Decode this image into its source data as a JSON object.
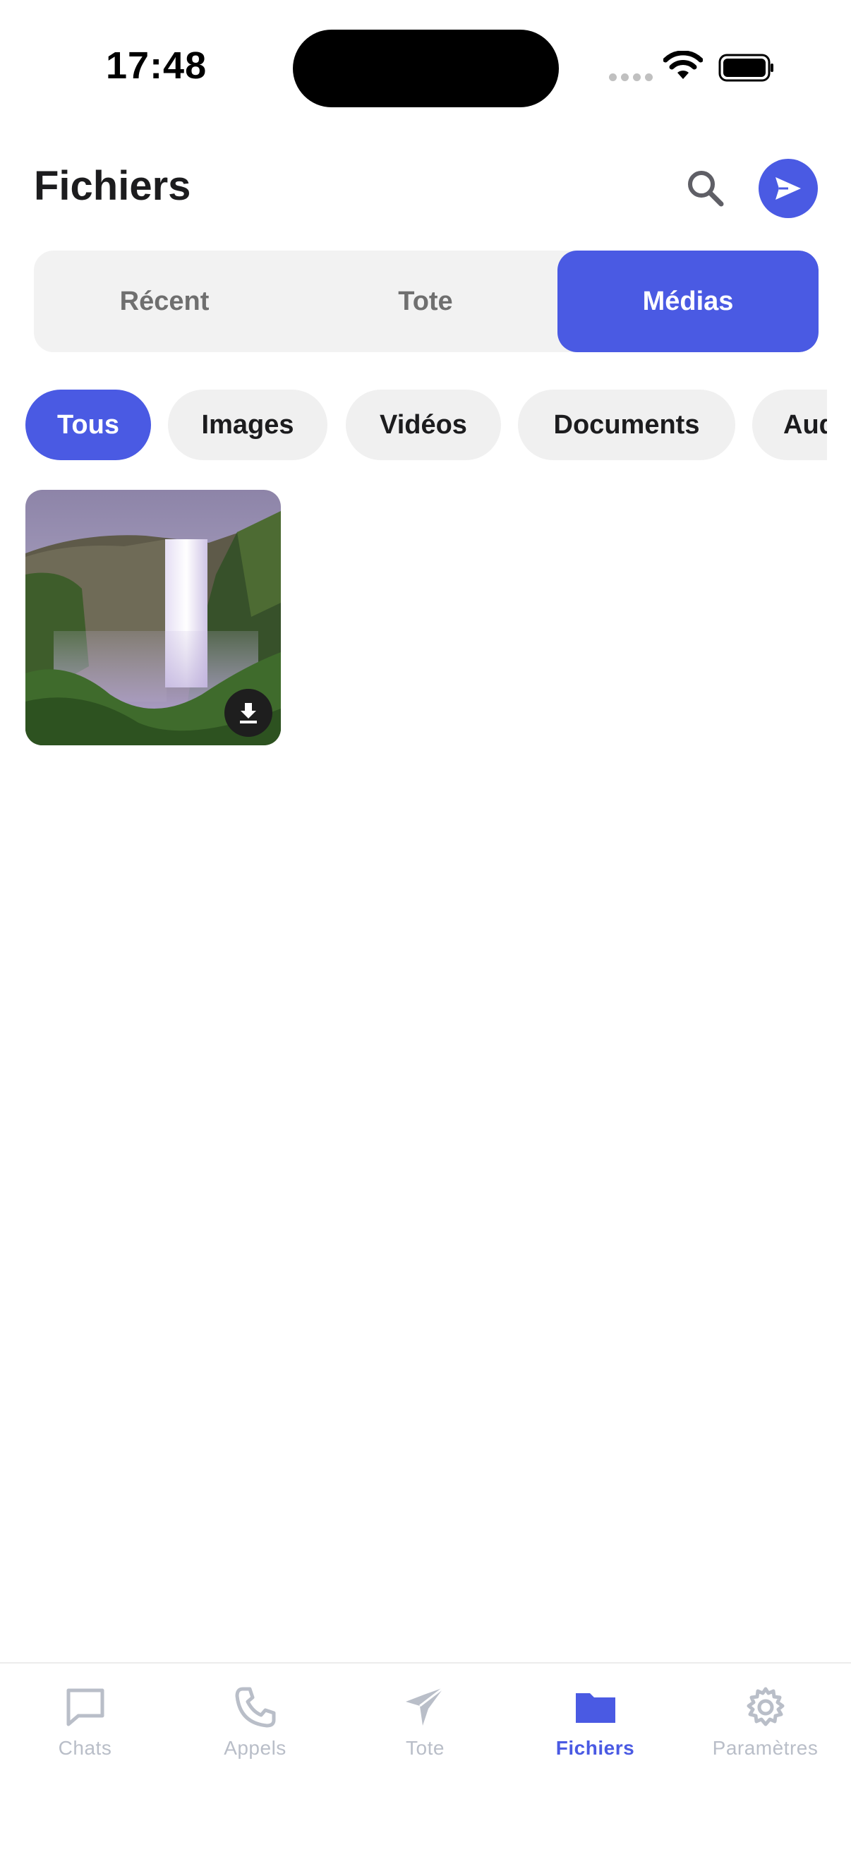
{
  "status_bar": {
    "time": "17:48"
  },
  "header": {
    "title": "Fichiers"
  },
  "segments": [
    {
      "label": "Récent"
    },
    {
      "label": "Tote"
    },
    {
      "label": "Médias"
    }
  ],
  "segment_selected": "Médias",
  "filters": [
    {
      "label": "Tous"
    },
    {
      "label": "Images"
    },
    {
      "label": "Vidéos"
    },
    {
      "label": "Documents"
    },
    {
      "label": "Aud"
    }
  ],
  "filter_selected": "Tous",
  "media": [
    {
      "type": "image",
      "icon": "download-icon"
    }
  ],
  "tabbar": {
    "items": [
      {
        "label": "Chats",
        "icon": "chat-icon"
      },
      {
        "label": "Appels",
        "icon": "phone-icon"
      },
      {
        "label": "Tote",
        "icon": "plane-icon"
      },
      {
        "label": "Fichiers",
        "icon": "folder-icon"
      },
      {
        "label": "Paramètres",
        "icon": "gear-icon"
      }
    ],
    "selected": "Fichiers"
  },
  "colors": {
    "accent": "#4a5ae3",
    "inactive": "#b9bec8",
    "chip_bg": "#f0f0f0",
    "segment_bg": "#f2f2f2"
  }
}
